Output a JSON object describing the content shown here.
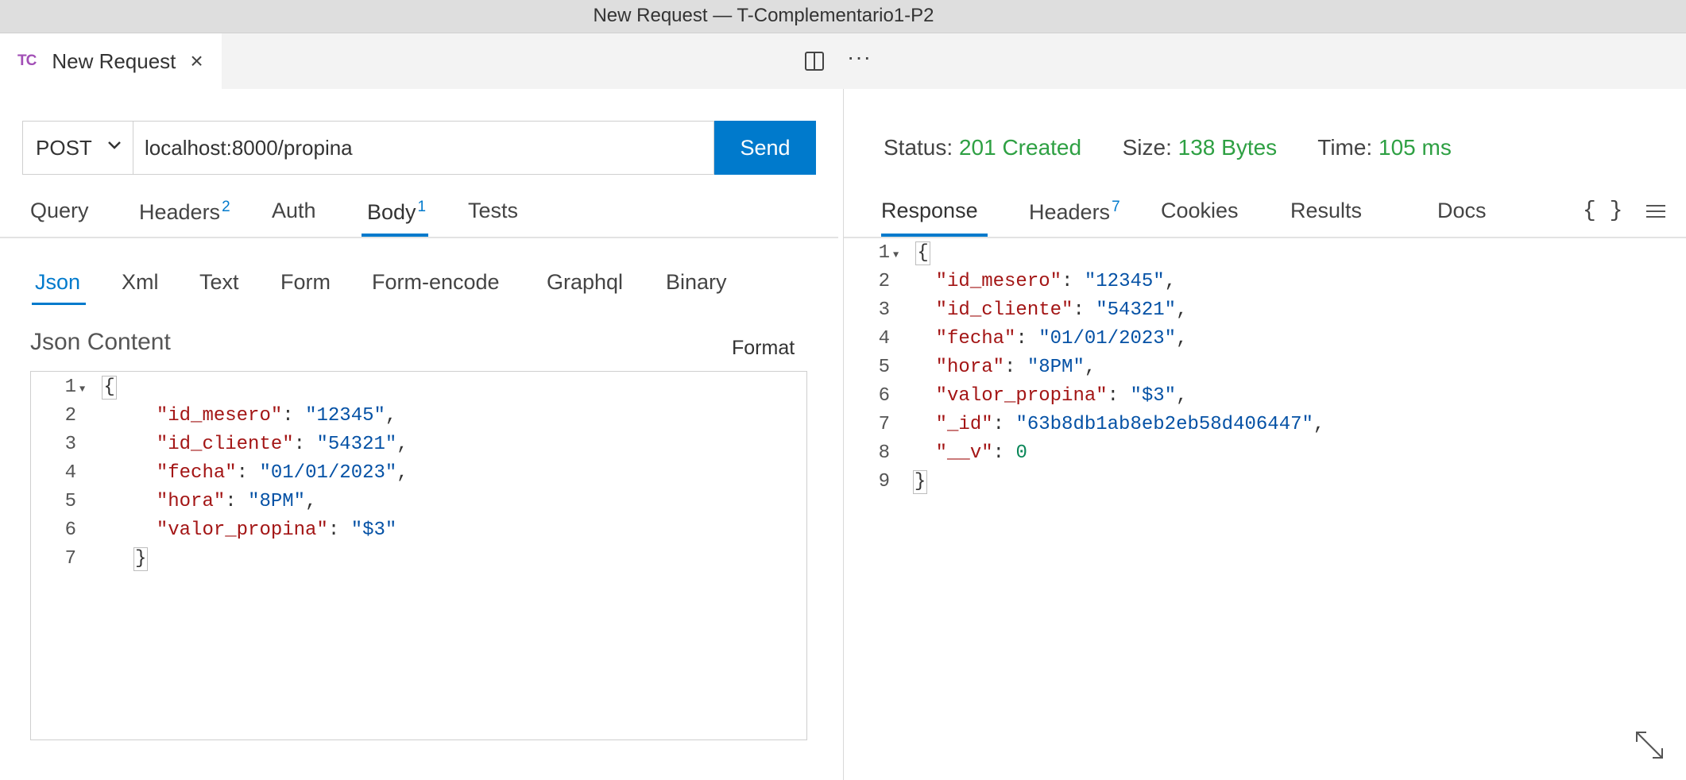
{
  "window": {
    "title": "New Request — T-Complementario1-P2"
  },
  "editor_tab": {
    "badge": "TC",
    "title": "New Request",
    "close_glyph": "×"
  },
  "toolbar": {
    "more_glyph": "···"
  },
  "request": {
    "method": "POST",
    "url": "localhost:8000/propina",
    "send_label": "Send"
  },
  "request_tabs": [
    {
      "label": "Query",
      "badge": ""
    },
    {
      "label": "Headers",
      "badge": "2"
    },
    {
      "label": "Auth",
      "badge": ""
    },
    {
      "label": "Body",
      "badge": "1"
    },
    {
      "label": "Tests",
      "badge": ""
    }
  ],
  "body_tabs": [
    "Json",
    "Xml",
    "Text",
    "Form",
    "Form-encode",
    "Graphql",
    "Binary"
  ],
  "json_content": {
    "label": "Json Content",
    "format_label": "Format",
    "line_numbers": [
      "1",
      "2",
      "3",
      "4",
      "5",
      "6",
      "7"
    ],
    "open_brace": "{",
    "close_brace": "}",
    "entries": [
      {
        "key": "\"id_mesero\"",
        "value": "\"12345\"",
        "sep": ","
      },
      {
        "key": "\"id_cliente\"",
        "value": "\"54321\"",
        "sep": ","
      },
      {
        "key": "\"fecha\"",
        "value": "\"01/01/2023\"",
        "sep": ","
      },
      {
        "key": "\"hora\"",
        "value": "\"8PM\"",
        "sep": ","
      },
      {
        "key": "\"valor_propina\"",
        "value": "\"$3\"",
        "sep": ""
      }
    ]
  },
  "response_status": {
    "status_label": "Status:",
    "status_value": "201 Created",
    "size_label": "Size:",
    "size_value": "138 Bytes",
    "time_label": "Time:",
    "time_value": "105 ms"
  },
  "response_tabs": [
    {
      "label": "Response",
      "badge": ""
    },
    {
      "label": "Headers",
      "badge": "7"
    },
    {
      "label": "Cookies",
      "badge": ""
    },
    {
      "label": "Results",
      "badge": ""
    },
    {
      "label": "Docs",
      "badge": ""
    }
  ],
  "response_icons": {
    "braces": "{ }"
  },
  "response_body": {
    "line_numbers": [
      "1",
      "2",
      "3",
      "4",
      "5",
      "6",
      "7",
      "8",
      "9"
    ],
    "open_brace": "{",
    "close_brace": "}",
    "entries": [
      {
        "key": "\"id_mesero\"",
        "value": "\"12345\"",
        "sep": ",",
        "type": "string"
      },
      {
        "key": "\"id_cliente\"",
        "value": "\"54321\"",
        "sep": ",",
        "type": "string"
      },
      {
        "key": "\"fecha\"",
        "value": "\"01/01/2023\"",
        "sep": ",",
        "type": "string"
      },
      {
        "key": "\"hora\"",
        "value": "\"8PM\"",
        "sep": ",",
        "type": "string"
      },
      {
        "key": "\"valor_propina\"",
        "value": "\"$3\"",
        "sep": ",",
        "type": "string"
      },
      {
        "key": "\"_id\"",
        "value": "\"63b8db1ab8eb2eb58d406447\"",
        "sep": ",",
        "type": "string"
      },
      {
        "key": "\"__v\"",
        "value": "0",
        "sep": "",
        "type": "number"
      }
    ]
  },
  "colors": {
    "accent": "#007acc",
    "status_green": "#2ea043",
    "json_key": "#a31515",
    "json_string": "#0451a5",
    "json_number": "#098658"
  }
}
